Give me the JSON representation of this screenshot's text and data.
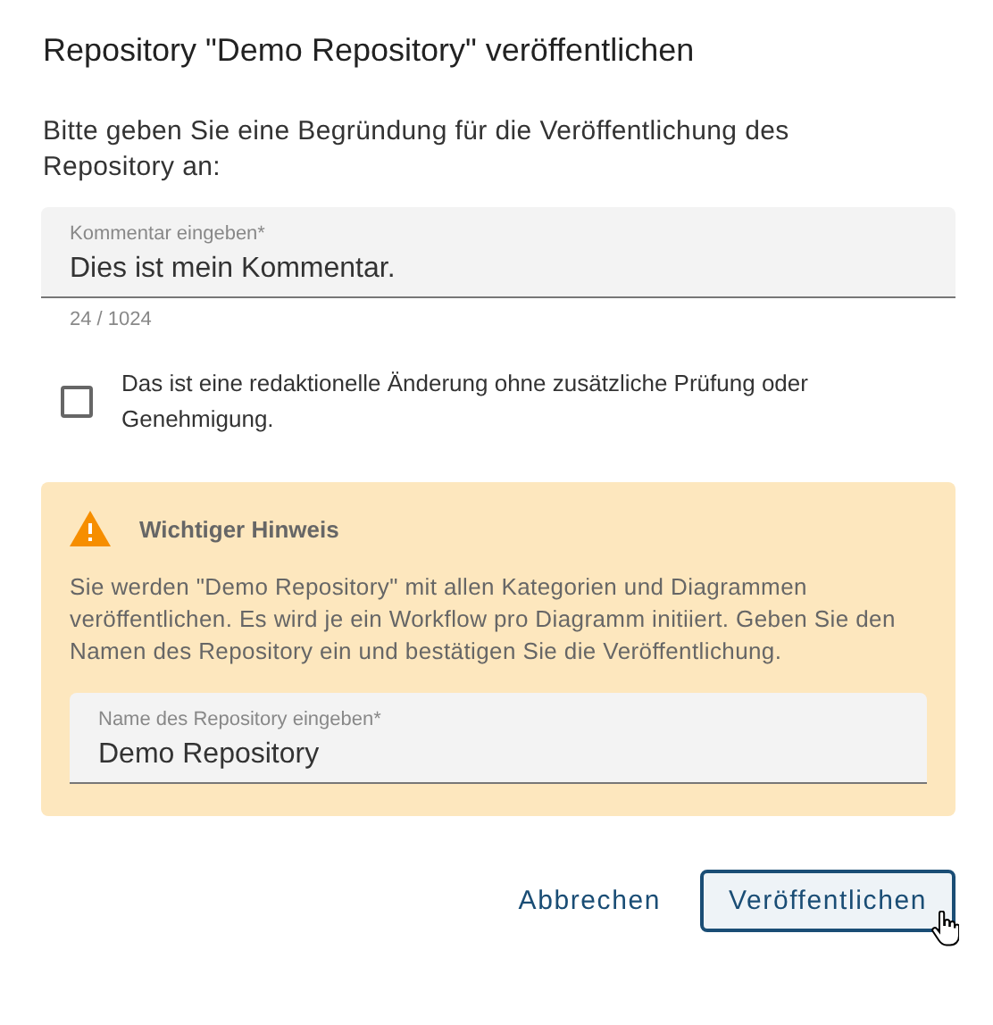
{
  "dialog": {
    "title": "Repository \"Demo Repository\" veröffentlichen",
    "description": "Bitte geben Sie eine Begründung für die Veröffentlichung des Repository an:",
    "comment_field": {
      "label": "Kommentar eingeben*",
      "value": "Dies ist mein Kommentar.",
      "counter": "24 / 1024"
    },
    "checkbox": {
      "label": "Das ist eine redaktionelle Änderung ohne zusätzliche Prüfung oder Genehmigung.",
      "checked": false
    },
    "notice": {
      "title": "Wichtiger Hinweis",
      "text": "Sie werden \"Demo Repository\" mit allen Kategorien und Diagrammen veröffentlichen. Es wird je ein Workflow pro Diagramm initiiert. Geben Sie den Namen des Repository ein und bestätigen Sie die Veröffentlichung.",
      "name_field": {
        "label": "Name des Repository eingeben*",
        "value": "Demo Repository"
      }
    },
    "buttons": [
      {
        "label": "Abbrechen",
        "kind": "text",
        "hovered": false
      },
      {
        "label": "Veröffentlichen",
        "kind": "outlined",
        "hovered": true
      }
    ]
  }
}
